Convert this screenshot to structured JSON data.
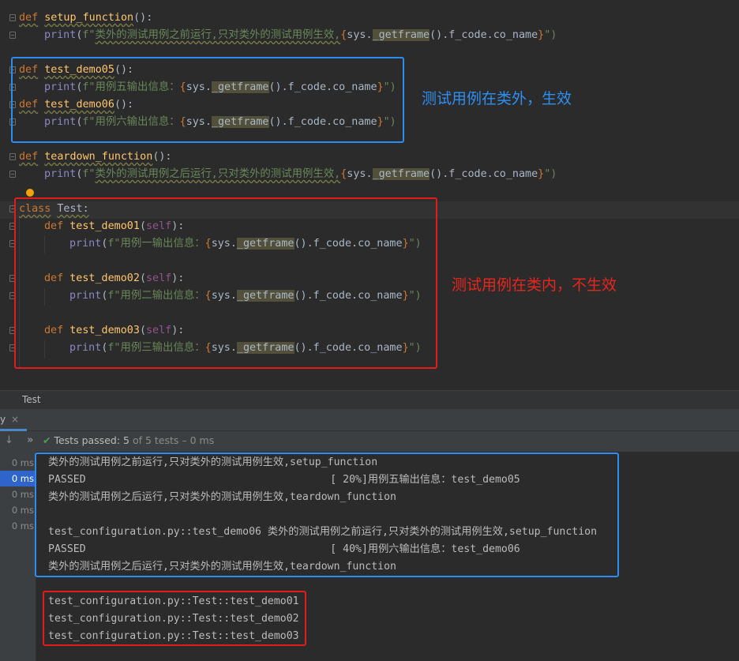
{
  "editor": {
    "lines": {
      "l1": {
        "kw": "def",
        "name": "setup_function",
        "paren": "():"
      },
      "l2": {
        "print": "print",
        "open": "(",
        "prefix": "f\"",
        "text": "类外的测试用例之前运行,只对类外的测试用例生效,",
        "lb": "{",
        "sys": "sys.",
        "method": "_getframe",
        "rest": "().f_code.co_name",
        "rb": "}",
        "close": "\")"
      },
      "l3": {
        "kw": "def",
        "name": "test_demo05",
        "paren": "():"
      },
      "l4": {
        "print": "print",
        "open": "(",
        "prefix": "f\"",
        "text": "用例五输出信息：",
        "lb": "{",
        "sys": "sys.",
        "method": "_getframe",
        "rest": "().f_code.co_name",
        "rb": "}",
        "close": "\")"
      },
      "l5": {
        "kw": "def",
        "name": "test_demo06",
        "paren": "():"
      },
      "l6": {
        "print": "print",
        "open": "(",
        "prefix": "f\"",
        "text": "用例六输出信息：",
        "lb": "{",
        "sys": "sys.",
        "method": "_getframe",
        "rest": "().f_code.co_name",
        "rb": "}",
        "close": "\")"
      },
      "l7": {
        "kw": "def",
        "name": "teardown_function",
        "paren": "():"
      },
      "l8": {
        "print": "print",
        "open": "(",
        "prefix": "f\"",
        "text": "类外的测试用例之后运行,只对类外的测试用例生效,",
        "lb": "{",
        "sys": "sys.",
        "method": "_getframe",
        "rest": "().f_code.co_name",
        "rb": "}",
        "close": "\")"
      },
      "l9": {
        "kw": "class",
        "name": "Test:"
      },
      "l10": {
        "kw": "def",
        "name": "test_demo01",
        "open": "(",
        "self": "self",
        "close": "):"
      },
      "l11": {
        "print": "print",
        "open": "(",
        "prefix": "f\"",
        "text": "用例一输出信息：",
        "lb": "{",
        "sys": "sys.",
        "method": "_getframe",
        "rest": "().f_code.co_name",
        "rb": "}",
        "close": "\")"
      },
      "l12": {
        "kw": "def",
        "name": "test_demo02",
        "open": "(",
        "self": "self",
        "close": "):"
      },
      "l13": {
        "print": "print",
        "open": "(",
        "prefix": "f\"",
        "text": "用例二输出信息：",
        "lb": "{",
        "sys": "sys.",
        "method": "_getframe",
        "rest": "().f_code.co_name",
        "rb": "}",
        "close": "\")"
      },
      "l14": {
        "kw": "def",
        "name": "test_demo03",
        "open": "(",
        "self": "self",
        "close": "):"
      },
      "l15": {
        "print": "print",
        "open": "(",
        "prefix": "f\"",
        "text": "用例三输出信息：",
        "lb": "{",
        "sys": "sys.",
        "method": "_getframe",
        "rest": "().f_code.co_name",
        "rb": "}",
        "close": "\")"
      }
    }
  },
  "annotations": {
    "blue_note": "测试用例在类外，生效",
    "red_note": "测试用例在类内，不生效"
  },
  "breadcrumb": "Test",
  "run_tab": {
    "label": "y",
    "close": "×"
  },
  "toolbar": {
    "icons": [
      "arrow-down-icon",
      "chevrons-icon"
    ],
    "status_prefix": "Tests passed:",
    "passed": "5",
    "status_suffix": "of 5 tests – 0 ms"
  },
  "tree": [
    "0 ms",
    "0 ms",
    "0 ms",
    "0 ms",
    "0 ms"
  ],
  "console": [
    "类外的测试用例之前运行,只对类外的测试用例生效,setup_function",
    "PASSED                                       [ 20%]用例五输出信息：test_demo05",
    "类外的测试用例之后运行,只对类外的测试用例生效,teardown_function",
    "",
    "test_configuration.py::test_demo06 类外的测试用例之前运行,只对类外的测试用例生效,setup_function",
    "PASSED                                       [ 40%]用例六输出信息：test_demo06",
    "类外的测试用例之后运行,只对类外的测试用例生效,teardown_function",
    "",
    "test_configuration.py::Test::test_demo01",
    "test_configuration.py::Test::test_demo02",
    "test_configuration.py::Test::test_demo03"
  ],
  "colors": {
    "accent_blue": "#2d8cf0",
    "accent_red": "#e21b1b",
    "pass_green": "#499c54"
  }
}
